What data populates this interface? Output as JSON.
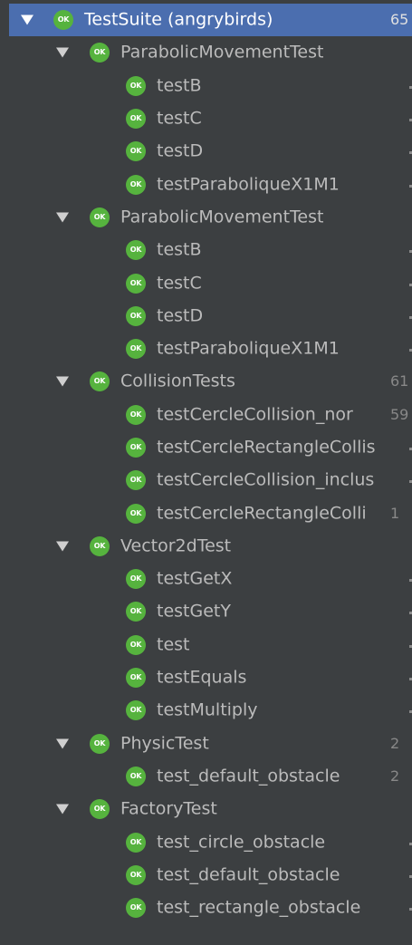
{
  "badge_text": "OK",
  "colors": {
    "background": "#3c3f41",
    "selection": "#4b6eaf",
    "pass": "#56b33e",
    "text": "#bbbbbb",
    "muted": "#888888"
  },
  "tree": [
    {
      "level": 0,
      "label": "TestSuite (angrybirds)",
      "count": "65",
      "expanded": true,
      "selected": true
    },
    {
      "level": 1,
      "label": "ParabolicMovementTest",
      "count": "",
      "expanded": true
    },
    {
      "level": 2,
      "label": "testB",
      "count": ""
    },
    {
      "level": 2,
      "label": "testC",
      "count": ""
    },
    {
      "level": 2,
      "label": "testD",
      "count": ""
    },
    {
      "level": 2,
      "label": "testParaboliqueX1M1",
      "count": ""
    },
    {
      "level": 1,
      "label": "ParabolicMovementTest",
      "count": "",
      "expanded": true
    },
    {
      "level": 2,
      "label": "testB",
      "count": ""
    },
    {
      "level": 2,
      "label": "testC",
      "count": ""
    },
    {
      "level": 2,
      "label": "testD",
      "count": ""
    },
    {
      "level": 2,
      "label": "testParaboliqueX1M1",
      "count": ""
    },
    {
      "level": 1,
      "label": "CollisionTests",
      "count": "61",
      "expanded": true
    },
    {
      "level": 2,
      "label": "testCercleCollision_nor",
      "count": "59"
    },
    {
      "level": 2,
      "label": "testCercleRectangleCollis",
      "count": ""
    },
    {
      "level": 2,
      "label": "testCercleCollision_inclus",
      "count": ""
    },
    {
      "level": 2,
      "label": "testCercleRectangleColli",
      "count": "1"
    },
    {
      "level": 1,
      "label": "Vector2dTest",
      "count": "",
      "expanded": true
    },
    {
      "level": 2,
      "label": "testGetX",
      "count": ""
    },
    {
      "level": 2,
      "label": "testGetY",
      "count": ""
    },
    {
      "level": 2,
      "label": "test",
      "count": ""
    },
    {
      "level": 2,
      "label": "testEquals",
      "count": ""
    },
    {
      "level": 2,
      "label": "testMultiply",
      "count": ""
    },
    {
      "level": 1,
      "label": "PhysicTest",
      "count": "2",
      "expanded": true
    },
    {
      "level": 2,
      "label": "test_default_obstacle",
      "count": "2"
    },
    {
      "level": 1,
      "label": "FactoryTest",
      "count": "",
      "expanded": true
    },
    {
      "level": 2,
      "label": "test_circle_obstacle",
      "count": ""
    },
    {
      "level": 2,
      "label": "test_default_obstacle",
      "count": ""
    },
    {
      "level": 2,
      "label": "test_rectangle_obstacle",
      "count": ""
    }
  ]
}
